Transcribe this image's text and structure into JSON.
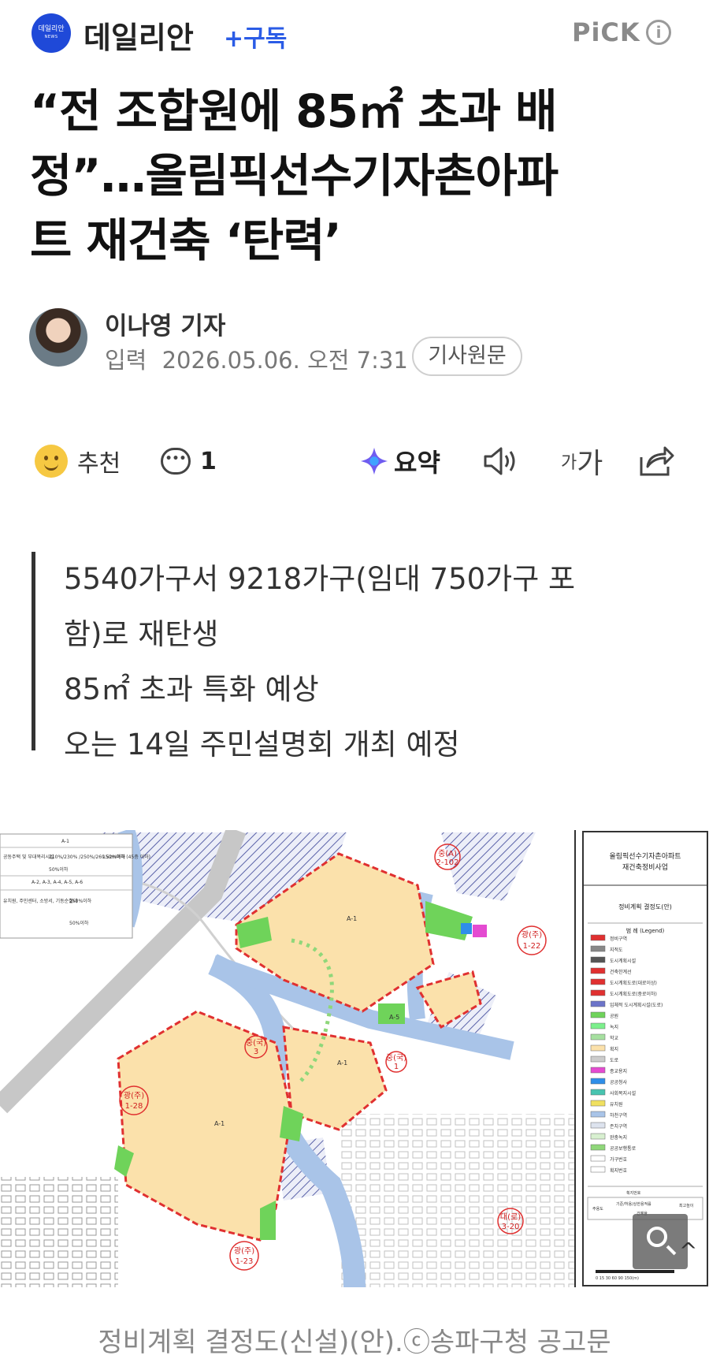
{
  "header": {
    "logo_text": "데일리안",
    "logo_sub": "NEWS",
    "publisher": "데일리안",
    "subscribe": "+구독",
    "pick": "PiCK"
  },
  "article": {
    "headline_line1": "“전 조합원에 85㎡ 초과 배",
    "headline_line2": "정”…올림픽선수기자촌아파",
    "headline_line3": "트 재건축 ‘탄력’",
    "author": "이나영 기자",
    "date_label": "입력",
    "date": "2026.05.06. 오전 7:31",
    "original_button": "기사원문"
  },
  "actions": {
    "recommend": "추천",
    "comment_count": "1",
    "summary": "요약",
    "font_small": "가",
    "font_large": "가"
  },
  "summary_lines": [
    "5540가구서 9218가구(임대 750가구 포",
    "함)로 재탄생",
    "85㎡ 초과 특화 예상",
    "오는 14일 주민설명회 개최 예정"
  ],
  "figure": {
    "legend_title_1": "올림픽선수기자촌아파트",
    "legend_title_2": "재건축정비사업",
    "plan_title": "정비계획 결정도(안)",
    "legend_header": "범 례 (Legend)",
    "legend_items": [
      "정비구역",
      "지적도",
      "도시계획시설",
      "건축한계선",
      "도시계획도로(대로이상)",
      "도시계획도로(중로이하)",
      "입체적 도시계획시설(도로)",
      "공원",
      "녹지",
      "학교",
      "획지",
      "도로",
      "종교용지",
      "공공청사",
      "사회복지시설",
      "유치원",
      "하천구역",
      "존치구역",
      "완충녹지",
      "공공보행통로",
      "가구번호",
      "획지번호"
    ],
    "table_header": "A-1",
    "table_row1_a": "공동주택 및 부대복리시설",
    "table_row1_b": "210%/230% /250%/269.52%이하",
    "table_row1_c": "150m이하 (45층 이하)",
    "table_row1_d": "50%이하",
    "table_header2": "A-2, A-3, A-4, A-5, A-6",
    "table_row2_a": "유치원, 주민센터, 소방서, 기동순찰대",
    "table_row2_b": "250%이하",
    "table_row2_c": "50%이하",
    "road_labels": [
      "중(A) 2-102",
      "광(주) 1-22",
      "중(국) 3",
      "중(국) 1",
      "광(주) 1-28",
      "광(주) 1-23",
      "대(로) 3-20"
    ],
    "block_labels": [
      "A-1",
      "A-1",
      "A-1",
      "A-5"
    ],
    "footer_labels": [
      "주용도",
      "기준/허용/상한용적률",
      "건폐율",
      "최고높이",
      "획지번호"
    ],
    "scale_label": "0 15 30 60 90 150(m)"
  },
  "caption": "정비계획 결정도(신설)(안).ⓒ송파구청 공고문"
}
